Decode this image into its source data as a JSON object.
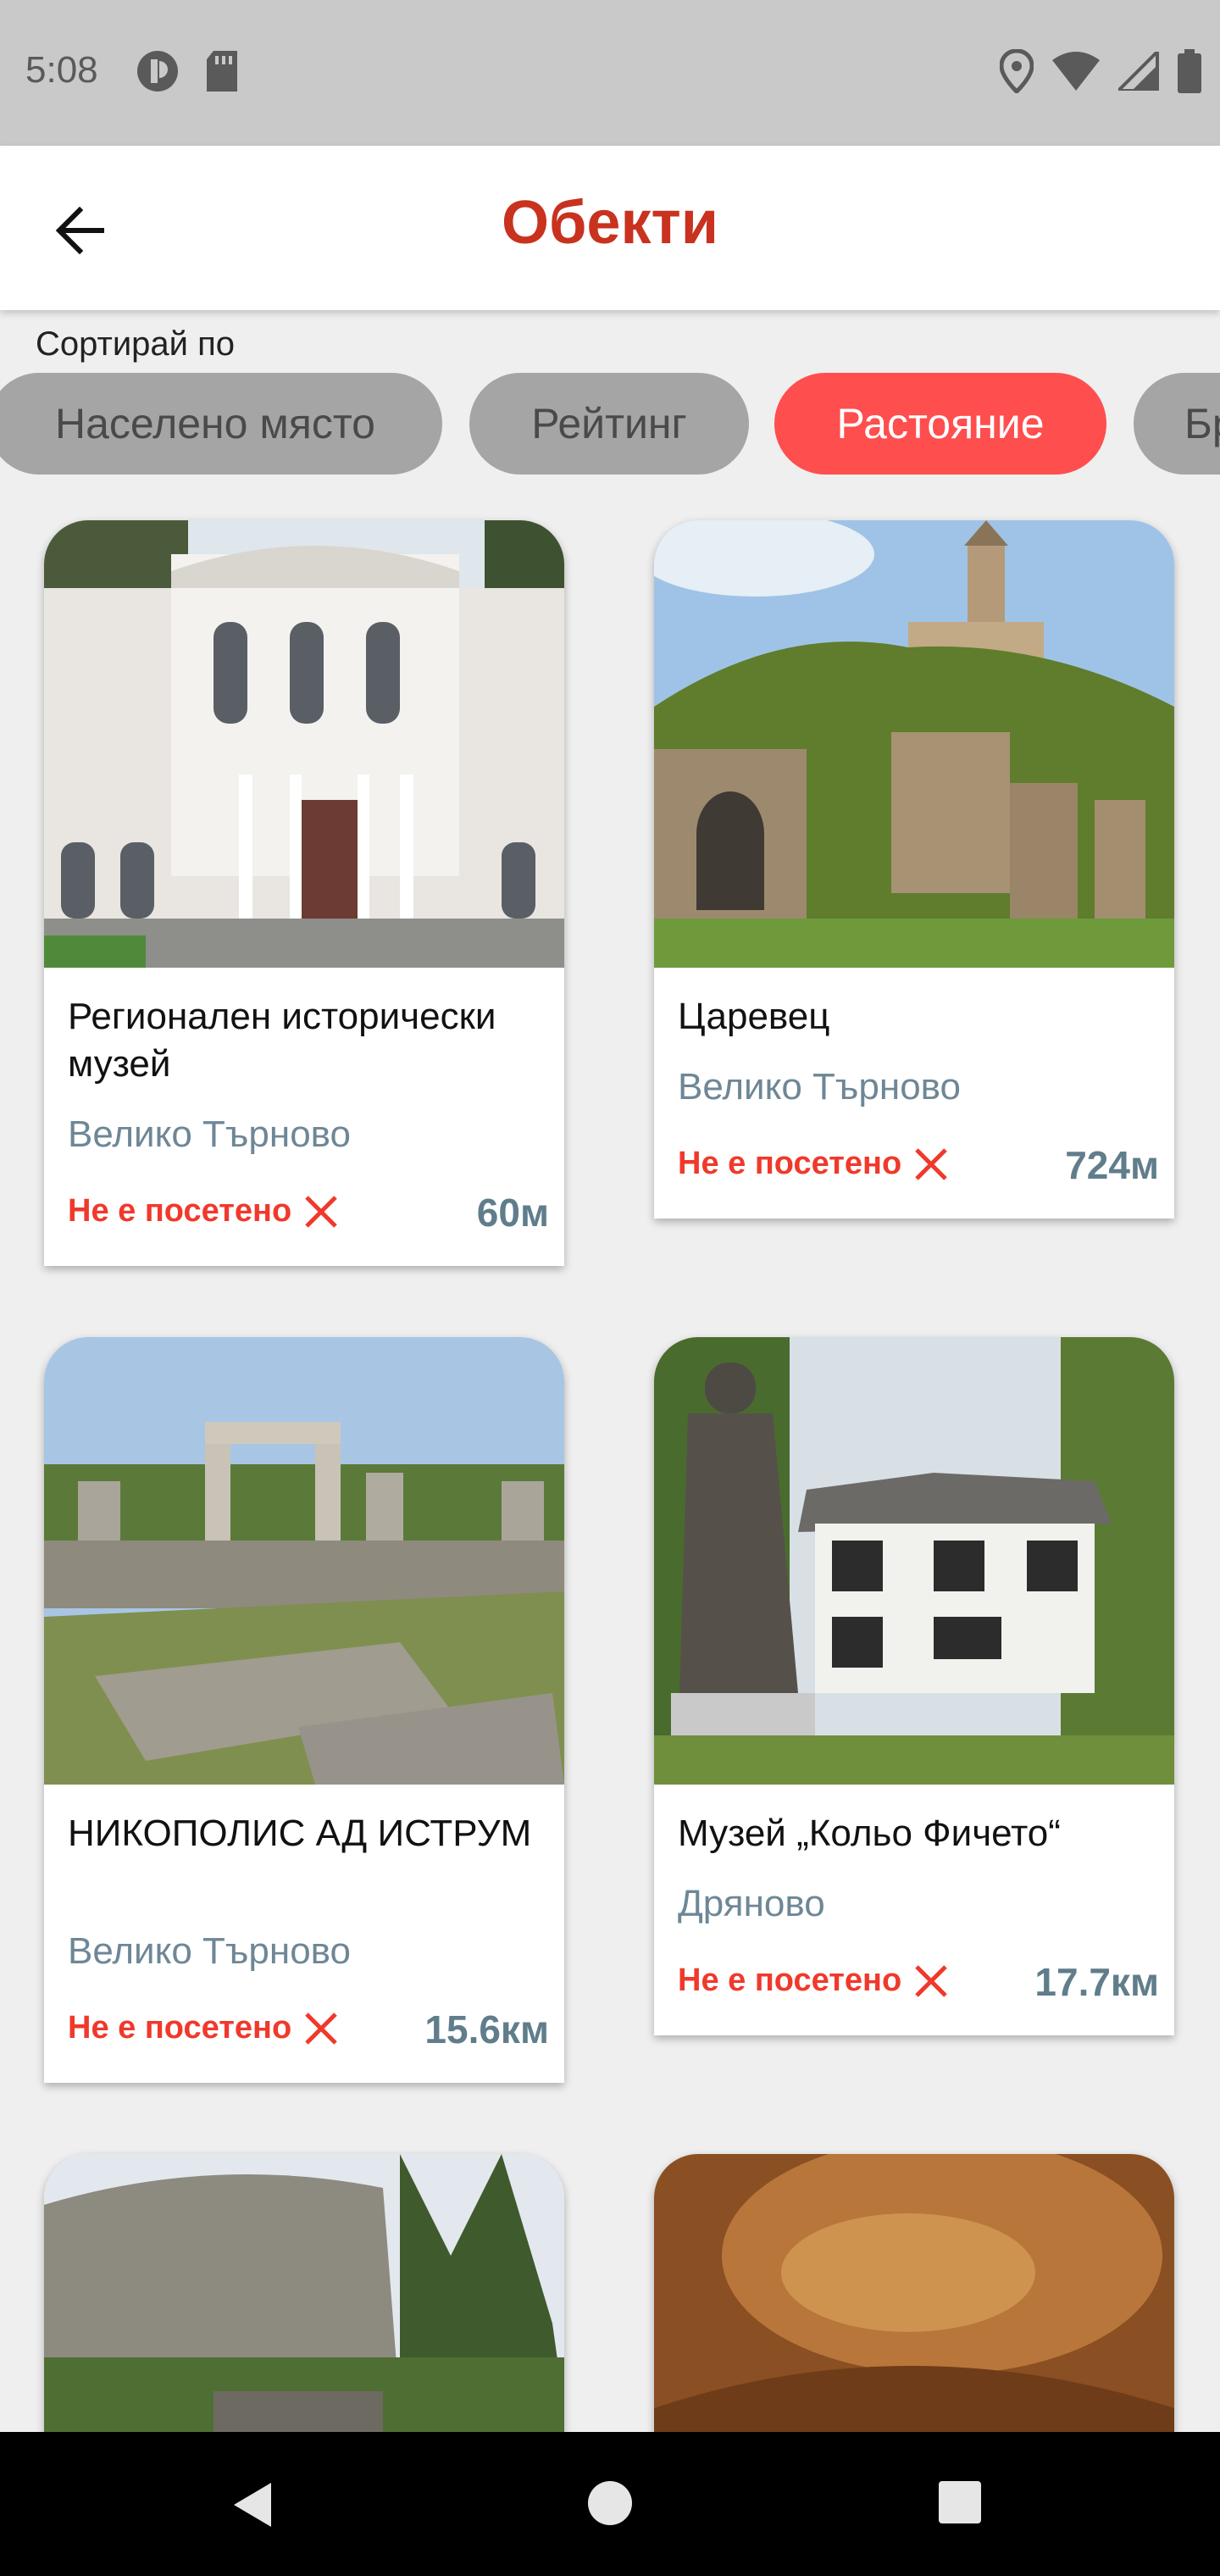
{
  "status_bar": {
    "time": "5:08",
    "icons_left": [
      "signal-privacy-icon",
      "sd-card-icon"
    ],
    "icons_right": [
      "location-icon",
      "wifi-icon",
      "cell-signal-icon",
      "battery-icon"
    ]
  },
  "app_bar": {
    "title": "Обекти",
    "back_icon": "arrow-back-icon"
  },
  "sort": {
    "label": "Сортирай по",
    "options": [
      "Населено място",
      "Рейтинг",
      "Растояние",
      "Бр"
    ],
    "selected": "Растояние"
  },
  "objects": [
    {
      "title": "Регионален исторически музей",
      "city": "Велико Търново",
      "status": "Не е посетено",
      "distance": "60м"
    },
    {
      "title": "Царевец",
      "city": "Велико Търново",
      "status": "Не е посетено",
      "distance": "724м"
    },
    {
      "title": "НИКОПОЛИС АД ИСТРУМ",
      "city": "Велико Търново",
      "status": "Не е посетено",
      "distance": "15.6км"
    },
    {
      "title": "Музей „Кольо Фичето“",
      "city": "Дряново",
      "status": "Не е посетено",
      "distance": "17.7км"
    }
  ],
  "colors": {
    "accent": "#c8321e",
    "chip_active": "#ff4e4e",
    "chip_inactive": "#a5a5a5",
    "status_red": "#f0392b",
    "city_gray": "#6e8796"
  },
  "nav_bar": {
    "icons": [
      "back-triangle-icon",
      "home-circle-icon",
      "recents-square-icon"
    ]
  }
}
